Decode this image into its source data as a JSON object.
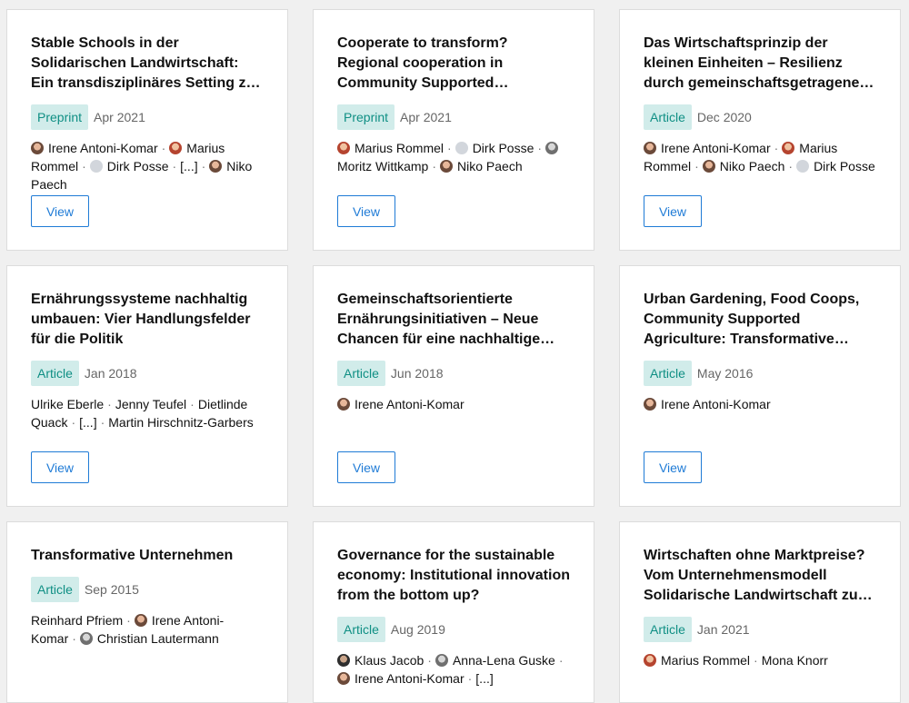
{
  "view_label": "View",
  "ellipsis": "[...]",
  "separator": "·",
  "cards": [
    {
      "title": "Stable Schools in der Solidarischen Landwirtschaft: Ein transdisziplinäres Setting zur Förderung von Bildung für nachhaltige Entwicklung",
      "type": "Preprint",
      "date": "Apr 2021",
      "authors": [
        {
          "name": "Irene Antoni-Komar",
          "avatar": "photo"
        },
        {
          "name": "Marius Rommel",
          "avatar": "photo-red"
        },
        {
          "name": "Dirk Posse",
          "avatar": "placeholder"
        },
        {
          "name": "[...]",
          "avatar": "none"
        },
        {
          "name": "Niko Paech",
          "avatar": "photo"
        }
      ]
    },
    {
      "title": "Cooperate to transform? Regional cooperation in Community Supported Agriculture",
      "type": "Preprint",
      "date": "Apr 2021",
      "authors": [
        {
          "name": "Marius Rommel",
          "avatar": "photo-red"
        },
        {
          "name": "Dirk Posse",
          "avatar": "placeholder"
        },
        {
          "name": "Moritz Wittkamp",
          "avatar": "photo-gray"
        },
        {
          "name": "Niko Paech",
          "avatar": "photo"
        }
      ]
    },
    {
      "title": "Das Wirtschaftsprinzip der kleinen Einheiten – Resilienz durch gemeinschaftsgetragene Versorgungsmodelle",
      "type": "Article",
      "date": "Dec 2020",
      "authors": [
        {
          "name": "Irene Antoni-Komar",
          "avatar": "photo"
        },
        {
          "name": "Marius Rommel",
          "avatar": "photo-red"
        },
        {
          "name": "Niko Paech",
          "avatar": "photo"
        },
        {
          "name": "Dirk Posse",
          "avatar": "placeholder"
        }
      ]
    },
    {
      "title": "Ernährungssysteme nachhaltig umbauen: Vier Handlungsfelder für die Politik",
      "type": "Article",
      "date": "Jan 2018",
      "authors": [
        {
          "name": "Ulrike Eberle",
          "avatar": "none"
        },
        {
          "name": "Jenny Teufel",
          "avatar": "none"
        },
        {
          "name": "Dietlinde Quack",
          "avatar": "none"
        },
        {
          "name": "[...]",
          "avatar": "none"
        },
        {
          "name": "Martin Hirschnitz-Garbers",
          "avatar": "none"
        }
      ]
    },
    {
      "title": "Gemeinschaftsorientierte Ernährungsinitiativen – Neue Chancen für eine nachhaltige Ernährungskultur",
      "type": "Article",
      "date": "Jun 2018",
      "authors": [
        {
          "name": "Irene Antoni-Komar",
          "avatar": "photo"
        }
      ]
    },
    {
      "title": "Urban Gardening, Food Coops, Community Supported Agriculture: Transformative Wirtschaftsformen",
      "type": "Article",
      "date": "May 2016",
      "authors": [
        {
          "name": "Irene Antoni-Komar",
          "avatar": "photo"
        }
      ]
    },
    {
      "title": "Transformative Unternehmen",
      "type": "Article",
      "date": "Sep 2015",
      "authors": [
        {
          "name": "Reinhard Pfriem",
          "avatar": "none"
        },
        {
          "name": "Irene Antoni-Komar",
          "avatar": "photo"
        },
        {
          "name": "Christian Lautermann",
          "avatar": "photo-gray"
        }
      ]
    },
    {
      "title": "Governance for the sustainable economy: Institutional innovation from the bottom up?",
      "type": "Article",
      "date": "Aug 2019",
      "authors": [
        {
          "name": "Klaus Jacob",
          "avatar": "photo-dark"
        },
        {
          "name": "Anna-Lena Guske",
          "avatar": "photo-gray"
        },
        {
          "name": "Irene Antoni-Komar",
          "avatar": "photo"
        },
        {
          "name": "[...]",
          "avatar": "none"
        }
      ]
    },
    {
      "title": "Wirtschaften ohne Marktpreise? Vom Unternehmensmodell Solidarische Landwirtschaft zu neuen Formen",
      "type": "Article",
      "date": "Jan 2021",
      "authors": [
        {
          "name": "Marius Rommel",
          "avatar": "photo-red"
        },
        {
          "name": "Mona Knorr",
          "avatar": "none"
        }
      ]
    }
  ]
}
